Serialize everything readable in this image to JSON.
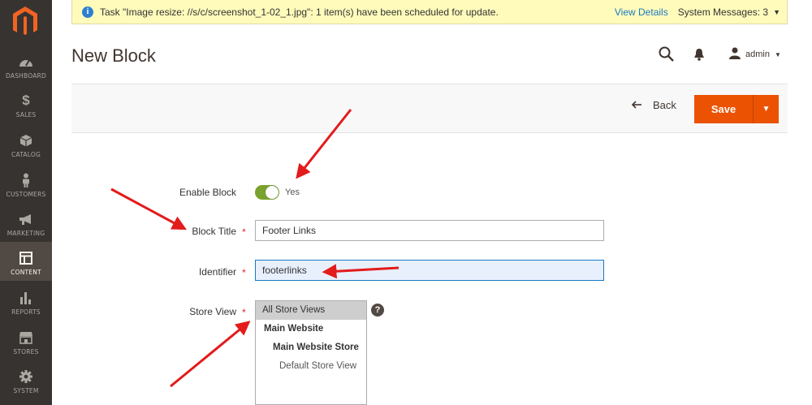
{
  "system_bar": {
    "message": "Task \"Image resize: //s/c/screenshot_1-02_1.jpg\": 1 item(s) have been scheduled for update.",
    "view_details": "View Details",
    "system_messages": "System Messages: 3"
  },
  "sidebar": {
    "items": [
      {
        "label": "DASHBOARD",
        "icon": "dashboard-icon"
      },
      {
        "label": "SALES",
        "icon": "dollar-icon"
      },
      {
        "label": "CATALOG",
        "icon": "box-icon"
      },
      {
        "label": "CUSTOMERS",
        "icon": "person-icon"
      },
      {
        "label": "MARKETING",
        "icon": "megaphone-icon"
      },
      {
        "label": "CONTENT",
        "icon": "layout-icon",
        "active": true
      },
      {
        "label": "REPORTS",
        "icon": "bar-chart-icon"
      },
      {
        "label": "STORES",
        "icon": "store-icon"
      },
      {
        "label": "SYSTEM",
        "icon": "gear-icon"
      }
    ]
  },
  "header": {
    "title": "New Block",
    "user": "admin"
  },
  "actions": {
    "back": "Back",
    "save": "Save"
  },
  "form": {
    "enable_block": {
      "label": "Enable Block",
      "value": "Yes"
    },
    "block_title": {
      "label": "Block Title",
      "value": "Footer Links"
    },
    "identifier": {
      "label": "Identifier",
      "value": "footerlinks"
    },
    "store_view": {
      "label": "Store View",
      "options": [
        "All Store Views",
        "Main Website",
        "Main Website Store",
        "Default Store View"
      ]
    }
  },
  "colors": {
    "accent": "#eb5202",
    "sidebar": "#373330",
    "toggle_on": "#79a22e",
    "annotation_arrow": "#e31b1b"
  }
}
